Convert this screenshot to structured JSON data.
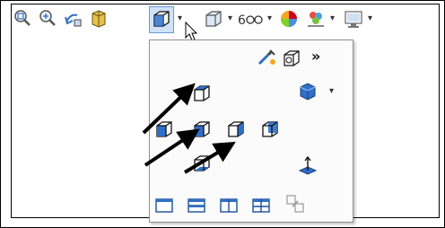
{
  "toolbar": {
    "items": [
      {
        "icon": "zoom-to-fit-icon"
      },
      {
        "icon": "zoom-to-area-icon"
      },
      {
        "icon": "previous-view-icon"
      },
      {
        "icon": "section-view-icon"
      },
      {
        "icon": "view-orientation-icon",
        "active": true,
        "dropdown": true
      },
      {
        "icon": "display-style-icon",
        "dropdown": true
      },
      {
        "icon": "hide-show-items-icon",
        "dropdown": true
      },
      {
        "icon": "edit-appearance-icon"
      },
      {
        "icon": "apply-scene-icon",
        "dropdown": true
      },
      {
        "icon": "view-settings-icon",
        "dropdown": true
      }
    ],
    "dropdown_glyph": "▾"
  },
  "flyout": {
    "top_row": {
      "icons": [
        "new-view-icon",
        "view-selector-icon"
      ],
      "more": "»"
    },
    "dimetric_dropdown_glyph": "▾",
    "views": [
      "top-view-icon",
      "left-view-icon",
      "front-view-icon",
      "right-view-icon",
      "back-view-icon",
      "bottom-view-icon",
      "isometric-view-icon",
      "dimetric-view-icon",
      "normal-to-icon"
    ],
    "viewports": [
      "single-view-icon",
      "two-view-horizontal-icon",
      "two-view-vertical-icon",
      "four-view-icon",
      "link-views-icon"
    ]
  },
  "colors": {
    "cube_blue": "#2f6fc7",
    "cube_dark": "#1a3f7a",
    "frame": "#000000",
    "flyout_border": "#8f8f8f"
  }
}
